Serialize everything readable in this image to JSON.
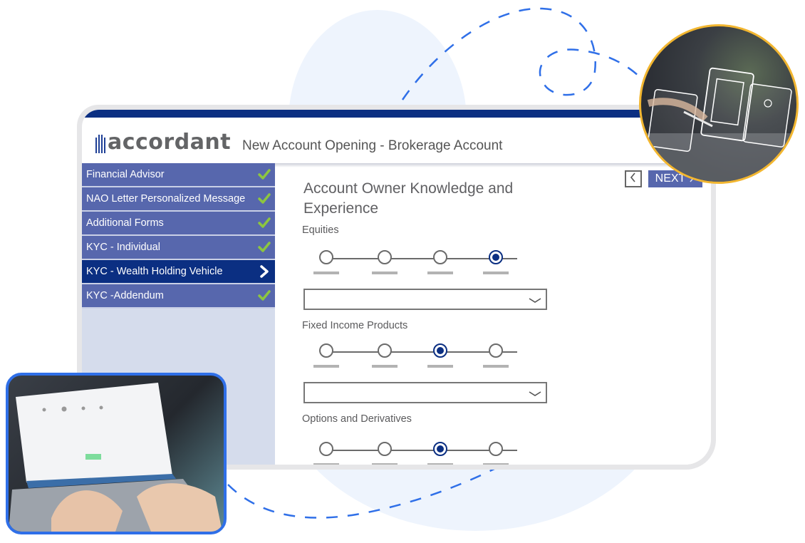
{
  "app": {
    "logo_text": "accordant",
    "title": "New Account Opening - Brokerage Account",
    "brand_color": "#0b2f82",
    "nav_color": "#5767ad",
    "check_color": "#8dc63f"
  },
  "sidebar": {
    "items": [
      {
        "label": "Financial Advisor",
        "status": "complete",
        "icon": "check-icon"
      },
      {
        "label": "NAO Letter Personalized Message",
        "status": "complete",
        "icon": "check-icon"
      },
      {
        "label": "Additional Forms",
        "status": "complete",
        "icon": "check-icon"
      },
      {
        "label": "KYC - Individual",
        "status": "complete",
        "icon": "check-icon"
      },
      {
        "label": "KYC - Wealth Holding Vehicle",
        "status": "active",
        "icon": "chevron-right-icon"
      },
      {
        "label": "KYC -Addendum",
        "status": "complete",
        "icon": "check-icon"
      }
    ]
  },
  "main": {
    "title": "Account Owner Knowledge and Experience",
    "prev_label": "<",
    "next_label": "NEXT",
    "questions": [
      {
        "label": "Equities",
        "options": 4,
        "selected_index": 3,
        "dropdown_value": ""
      },
      {
        "label": "Fixed Income Products",
        "options": 4,
        "selected_index": 2,
        "dropdown_value": ""
      },
      {
        "label": "Options and Derivatives",
        "options": 4,
        "selected_index": 2
      }
    ]
  },
  "decor": {
    "photo_right": "person-tapping-virtual-documents-photo",
    "photo_left": "hands-typing-on-laptop-photo"
  }
}
